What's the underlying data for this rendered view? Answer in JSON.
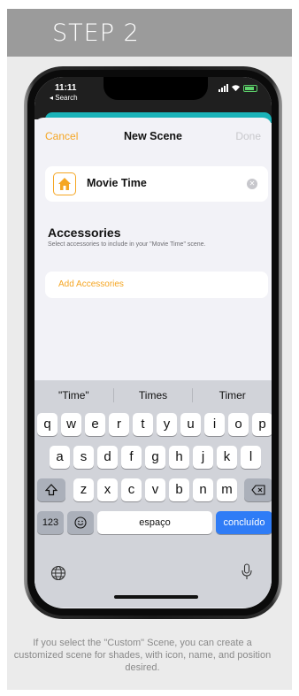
{
  "header": {
    "step": "STEP 2"
  },
  "status": {
    "time": "11:11",
    "back": "◂ Search"
  },
  "nav": {
    "cancel": "Cancel",
    "title": "New Scene",
    "done": "Done"
  },
  "scene": {
    "name": "Movie Time"
  },
  "accessories": {
    "title": "Accessories",
    "subtitle": "Select accessories to include in your \"Movie Time\" scene.",
    "add": "Add Accessories"
  },
  "keyboard": {
    "suggestions": [
      "\"Time\"",
      "Times",
      "Timer"
    ],
    "row1": [
      "q",
      "w",
      "e",
      "r",
      "t",
      "y",
      "u",
      "i",
      "o",
      "p"
    ],
    "row2": [
      "a",
      "s",
      "d",
      "f",
      "g",
      "h",
      "j",
      "k",
      "l"
    ],
    "row3": [
      "z",
      "x",
      "c",
      "v",
      "b",
      "n",
      "m"
    ],
    "numbers": "123",
    "space": "espaço",
    "return": "concluído"
  },
  "caption": "If you select the \"Custom\" Scene, you can create a customized scene for shades, with icon, name, and position desired.",
  "colors": {
    "accent": "#f5a623",
    "header": "#9b9b9b",
    "return_key": "#2f7cf6"
  }
}
